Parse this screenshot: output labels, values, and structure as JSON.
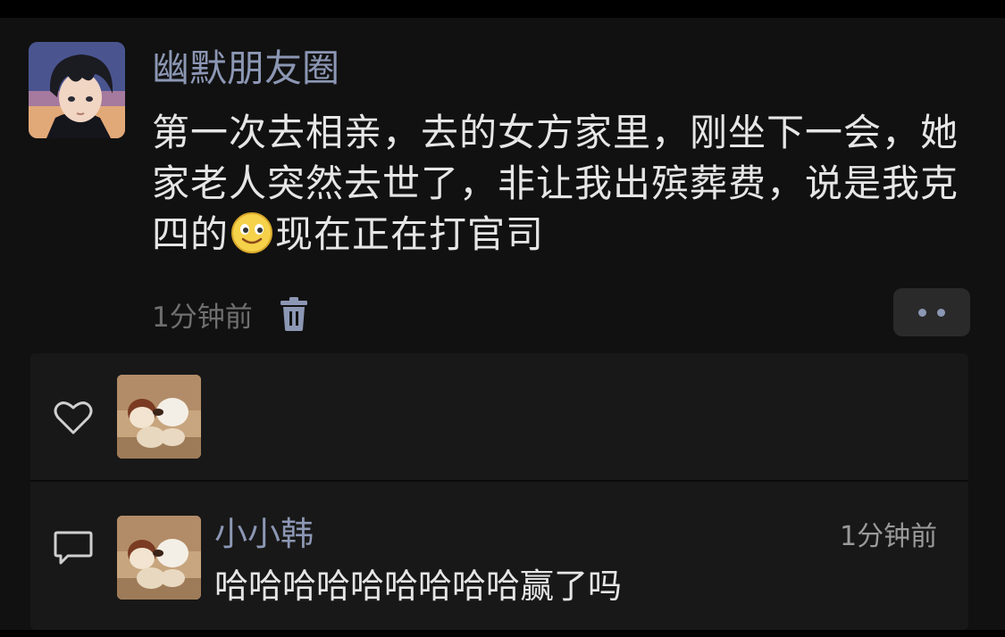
{
  "post": {
    "author": "幽默朋友圈",
    "text_before_emoji": "第一次去相亲，去的女方家里，刚坐下一会，她家老人突然去世了，非让我出殡葬费，说是我克四的",
    "emoji": "smile-emoji-icon",
    "text_after_emoji": "现在正在打官司",
    "time": "1分钟前",
    "delete_icon": "trash-icon",
    "more_icon": "more-dots-icon"
  },
  "likes": {
    "icon": "heart-icon",
    "avatars": [
      "avatar"
    ]
  },
  "comments": [
    {
      "icon": "comment-icon",
      "author": "小小韩",
      "time": "1分钟前",
      "text": "哈哈哈哈哈哈哈哈哈赢了吗"
    }
  ],
  "colors": {
    "background": "#111111",
    "name": "#8c97b4",
    "text": "#e6e6e6",
    "muted": "#6f6f6f"
  }
}
